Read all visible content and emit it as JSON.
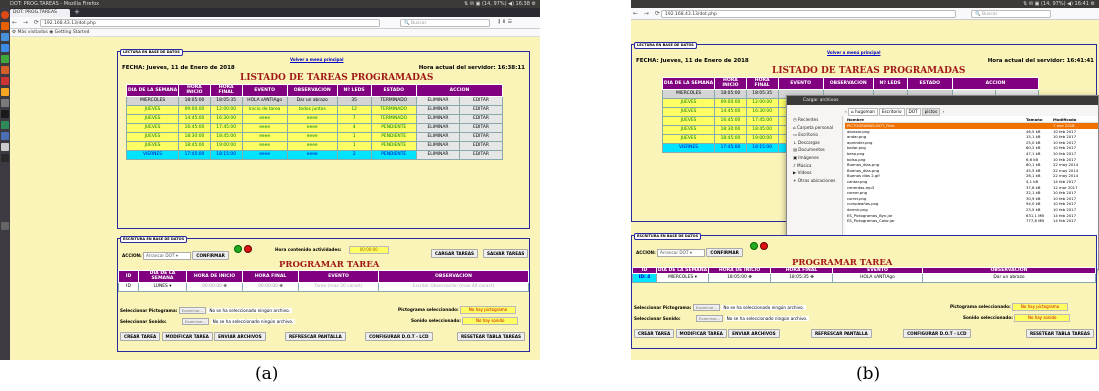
{
  "a": {
    "os_bar_title": "DOT: PROG.TAREAS - Mozilla Firefox",
    "os_bar_right": "⇅  ✉  ▣  (14, 97%)  ◀)  16:38  ⚙",
    "tab_label": "DOT: PROG.TAREAS",
    "url": "192.168.43.13/dot.php",
    "search_placeholder": "Buscar",
    "bookmarks": "⚙ Más visitados  ◉ Getting Started",
    "top_panel_tag": "LECTURA EN BASE DE DATOS",
    "fecha": "FECHA: Jueves, 11 de Enero de 2018",
    "menu_link": "Volver a menú principal",
    "hora_servidor": "Hora actual del servidor: 16:38:11",
    "list_title": "LISTADO DE TAREAS PROGRAMADAS",
    "headers": [
      "DIA DE LA SEMANA",
      "HORA INICIO",
      "HORA FINAL",
      "EVENTO",
      "OBSERVACION",
      "Nº LEDS",
      "ESTADO",
      "ACCION"
    ],
    "rows": [
      {
        "dia": "MIERCOLES",
        "ini": "18:05:00",
        "fin": "18:05:35",
        "evento": "HOLA sANTIAgo",
        "obs": "Dar un abrazo",
        "leds": "35",
        "estado": "TERMINADO",
        "kind": "term"
      },
      {
        "dia": "JUEVES",
        "ini": "09:00:00",
        "fin": "12:00:00",
        "evento": "Inicio de tarea",
        "obs": "todos juntos",
        "leds": "12",
        "estado": "TERMINADO",
        "kind": "green"
      },
      {
        "dia": "JUEVES",
        "ini": "14:45:00",
        "fin": "16:30:00",
        "evento": "eeee",
        "obs": "eeee",
        "leds": "7",
        "estado": "TERMINADO",
        "kind": "green"
      },
      {
        "dia": "JUEVES",
        "ini": "16:45:00",
        "fin": "17:45:00",
        "evento": "eeee",
        "obs": "eeee",
        "leds": "4",
        "estado": "PENDIENTE",
        "kind": "green"
      },
      {
        "dia": "JUEVES",
        "ini": "18:30:00",
        "fin": "18:45:00",
        "evento": "eeee",
        "obs": "eeee",
        "leds": "1",
        "estado": "PENDIENTE",
        "kind": "green"
      },
      {
        "dia": "JUEVES",
        "ini": "18:45:00",
        "fin": "19:00:00",
        "evento": "eeee",
        "obs": "eeee",
        "leds": "1",
        "estado": "PENDIENTE",
        "kind": "green"
      },
      {
        "dia": "VIERNES",
        "ini": "17:45:00",
        "fin": "18:15:00",
        "evento": "eeee",
        "obs": "eeee",
        "leds": "2",
        "estado": "PENDIENTE",
        "kind": "blue"
      }
    ],
    "btn_eliminar": "ELIMINAR",
    "btn_editar": "EDITAR",
    "bottom_panel_tag": "ESCRITURA EN BASE DE DATOS",
    "accion_label": "ACCION:",
    "accion_value": "Arrancar DOT",
    "btn_confirmar": "CONFIRMAR",
    "hora_contenido_label": "Hora contenido actividades:",
    "hora_contenido_value": "00:00:00",
    "btn_cargar": "CARGAR TAREAS",
    "btn_salvar": "SALVAR TAREAS",
    "prog_title": "PROGRAMAR TAREA",
    "prog_headers": [
      "ID",
      "DIA DE LA SEMANA",
      "HORA DE INICIO",
      "HORA FINAL",
      "EVENTO",
      "OBSERVACION"
    ],
    "prog_id": "ID",
    "prog_dia": "LUNES",
    "prog_ini": "00:00:00",
    "prog_fin": "00:00:00",
    "prog_evento_ph": "Tarea (max 20 caract)",
    "prog_obs_ph": "Escribir Observación (max 40 caract)",
    "sel_pictograma": "Seleccionar Pictograma:",
    "sel_sonido": "Seleccionar Sonido:",
    "examinar": "Examinar...",
    "no_archivo": "No se ha seleccionado ningún archivo.",
    "pict_sel_label": "Pictograma seleccionado:",
    "pict_sel_value": "No hay pictograma",
    "sonido_sel_label": "Sonido seleccionado:",
    "sonido_sel_value": "No hay sonido",
    "btn_crear": "CREAR TAREA",
    "btn_modificar": "MODIFICAR TAREA",
    "btn_enviar": "ENVIAR ARCHIVOS",
    "btn_refrescar": "REFRESCAR PANTALLA",
    "btn_configurar": "CONFIGURAR D.O.T - LCD",
    "btn_resetear": "RESETEAR TABLA TAREAS"
  },
  "b": {
    "os_bar_right": "⇅  ✉  ▣  (14, 97%)  ◀)  16:41  ⚙",
    "url": "192.168.43.13/dot.php",
    "search_placeholder": "Buscar",
    "fecha": "FECHA: Jueves, 11 de Enero de 2018",
    "menu_link": "Volver a menú principal",
    "hora_servidor": "Hora actual del servidor: 16:41:41",
    "list_title": "LISTADO DE TAREAS PROGRAMADAS",
    "headers": [
      "DIA DE LA SEMANA",
      "HORA INICIO",
      "HORA FINAL",
      "EVENTO",
      "OBSERVACION",
      "Nº LEDS",
      "ESTADO",
      "ACCION"
    ],
    "rows": [
      {
        "dia": "MIERCOLES",
        "ini": "18:05:00",
        "fin": "18:05:35",
        "kind": "term"
      },
      {
        "dia": "JUEVES",
        "ini": "09:00:00",
        "fin": "12:00:00",
        "kind": "green"
      },
      {
        "dia": "JUEVES",
        "ini": "14:45:00",
        "fin": "16:30:00",
        "kind": "green"
      },
      {
        "dia": "JUEVES",
        "ini": "16:45:00",
        "fin": "17:45:00",
        "kind": "green"
      },
      {
        "dia": "JUEVES",
        "ini": "18:30:00",
        "fin": "18:45:00",
        "kind": "green"
      },
      {
        "dia": "JUEVES",
        "ini": "18:45:00",
        "fin": "19:00:00",
        "kind": "green"
      },
      {
        "dia": "VIERNES",
        "ini": "17:45:00",
        "fin": "18:15:00",
        "kind": "blue"
      }
    ],
    "dialog_title": "Cargar archivos",
    "path": [
      "hugoman",
      "Escritorio",
      "DOT",
      "pictos"
    ],
    "sidebar": [
      "Recientes",
      "Carpeta personal",
      "Escritorio",
      "Descargas",
      "Documentos",
      "Imágenes",
      "Música",
      "Vídeos",
      "+ Otras ubicaciones"
    ],
    "col_nombre": "Nombre",
    "col_tamano": "Tamaño",
    "col_modificado": "Modificado",
    "files": [
      {
        "n": "PICTOGRAMAS-DOT_Files",
        "s": "",
        "m": "7 ene 2018"
      },
      {
        "n": "abrazar.png",
        "s": "46,5 kB",
        "m": "10 feb 2017"
      },
      {
        "n": "andar.png",
        "s": "15,1 kB",
        "m": "10 feb 2017"
      },
      {
        "n": "aprender.png",
        "s": "25,0 kB",
        "m": "10 feb 2017"
      },
      {
        "n": "bailar.png",
        "s": "60,2 kB",
        "m": "10 feb 2017"
      },
      {
        "n": "beso.png",
        "s": "47,1 kB",
        "m": "10 feb 2017"
      },
      {
        "n": "bolso.png",
        "s": "6,6 kB",
        "m": "10 feb 2017"
      },
      {
        "n": "Buenos_días.png",
        "s": "80,1 kB",
        "m": "22 may 2014"
      },
      {
        "n": "Buenos_días.png",
        "s": "45,5 kB",
        "m": "22 may 2014"
      },
      {
        "n": "Buenos días 2.gif",
        "s": "26,1 kB",
        "m": "22 may 2014"
      },
      {
        "n": "cantar.png",
        "s": "4,1 kB",
        "m": "14 feb 2017"
      },
      {
        "n": "cenerdas.mp3",
        "s": "37,6 kB",
        "m": "12 mar 2017"
      },
      {
        "n": "comer.png",
        "s": "32,1 kB",
        "m": "10 feb 2017"
      },
      {
        "n": "correr.png",
        "s": "30,9 kB",
        "m": "10 feb 2017"
      },
      {
        "n": "cumpleaños.png",
        "s": "94,0 kB",
        "m": "10 feb 2017"
      },
      {
        "n": "dormir.png",
        "s": "23,5 kB",
        "m": "10 feb 2017"
      },
      {
        "n": "ES_Pictogramas_Byn.jar",
        "s": "631,1 MB",
        "m": "14 feb 2017"
      },
      {
        "n": "ES_Pictogramas_Color.jar",
        "s": "777,8 MB",
        "m": "14 feb 2017"
      }
    ],
    "filter": "Todos los archivos ▾",
    "btn_cancelar": "Cancelar",
    "btn_abrir": "Abrir",
    "accion_label": "ACCION:",
    "accion_value": "Arrancar DOT",
    "btn_confirmar": "CONFIRMAR",
    "prog_title": "PROGRAMAR TAREA",
    "prog_id": "ID: 4",
    "prog_dia": "MIERCOLES",
    "prog_ini": "18:05:00",
    "prog_fin": "18:05:35",
    "prog_evento": "HOLA sANTIAgo",
    "prog_obs": "Dar un abrazo"
  },
  "labels": {
    "a": "(a)",
    "b": "(b)"
  },
  "colors": {
    "header": "#800080",
    "page_bg": "#faf4b8",
    "border": "#2a2aa0",
    "title": "#a01818",
    "done": "#d4d4d4",
    "pending": "#ffff64",
    "today": "#00e4ff"
  }
}
